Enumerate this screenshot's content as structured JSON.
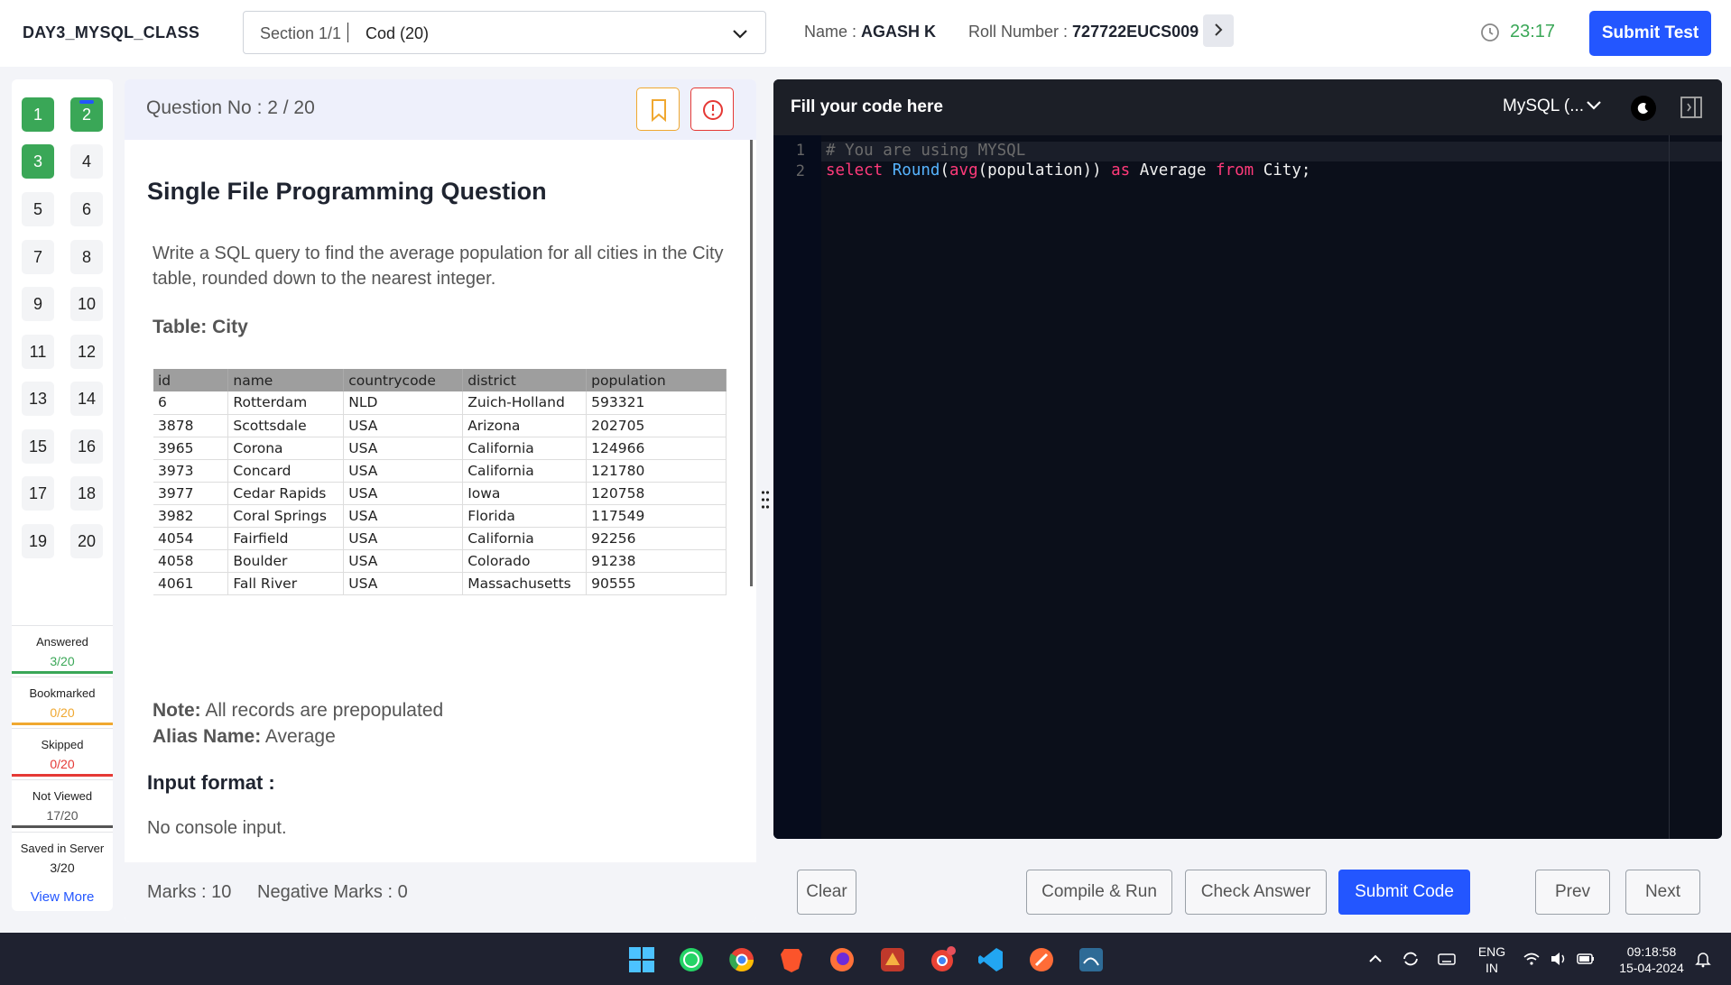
{
  "header": {
    "test_title": "DAY3_MYSQL_CLASS",
    "section_label": "Section 1/1",
    "section_value": "Cod (20)",
    "name_label": "Name :",
    "name_value": "AGASH K",
    "roll_label": "Roll Number :",
    "roll_value": "727722EUCS009",
    "timer": "23:17",
    "submit_test": "Submit Test"
  },
  "qnav": {
    "questions": [
      "1",
      "2",
      "3",
      "4",
      "5",
      "6",
      "7",
      "8",
      "9",
      "10",
      "11",
      "12",
      "13",
      "14",
      "15",
      "16",
      "17",
      "18",
      "19",
      "20"
    ],
    "answered": [
      "1",
      "2",
      "3"
    ],
    "current": "2",
    "stats": [
      {
        "label": "Answered",
        "value": "3/20",
        "color": "#3aa757"
      },
      {
        "label": "Bookmarked",
        "value": "0/20",
        "color": "#f0a830"
      },
      {
        "label": "Skipped",
        "value": "0/20",
        "color": "#e53935"
      },
      {
        "label": "Not Viewed",
        "value": "17/20",
        "color": "#555555"
      },
      {
        "label": "Saved in Server",
        "value": "3/20",
        "color": "#222222"
      }
    ],
    "view_more": "View More"
  },
  "question": {
    "number_label": "Question No : 2 / 20",
    "type_title": "Single File Programming Question",
    "text": "Write a SQL query to find the average population for all cities in the City table, rounded down to the nearest integer.",
    "table_caption": "Table: City",
    "table": {
      "columns": [
        "id",
        "name",
        "countrycode",
        "district",
        "population"
      ],
      "rows": [
        [
          "6",
          "Rotterdam",
          "NLD",
          "Zuich-Holland",
          "593321"
        ],
        [
          "3878",
          "Scottsdale",
          "USA",
          "Arizona",
          "202705"
        ],
        [
          "3965",
          "Corona",
          "USA",
          "California",
          "124966"
        ],
        [
          "3973",
          "Concard",
          "USA",
          "California",
          "121780"
        ],
        [
          "3977",
          "Cedar Rapids",
          "USA",
          "Iowa",
          "120758"
        ],
        [
          "3982",
          "Coral Springs",
          "USA",
          "Florida",
          "117549"
        ],
        [
          "4054",
          "Fairfield",
          "USA",
          "California",
          "92256"
        ],
        [
          "4058",
          "Boulder",
          "USA",
          "Colorado",
          "91238"
        ],
        [
          "4061",
          "Fall River",
          "USA",
          "Massachusetts",
          "90555"
        ]
      ]
    },
    "note_label": "Note:",
    "note_value": "All records are prepopulated",
    "alias_label": "Alias Name:",
    "alias_value": "Average",
    "input_format_title": "Input format :",
    "input_format_value": "No console input.",
    "marks": "Marks : 10",
    "negative_marks": "Negative Marks : 0"
  },
  "editor": {
    "header_label": "Fill your code here",
    "language": "MySQL (...",
    "line_numbers": [
      "1",
      "2"
    ],
    "line1_comment": "# You are using MYSQL",
    "line2": {
      "t1": "select",
      "t2": " ",
      "t3": "Round",
      "t4": "(",
      "t5": "avg",
      "t6": "(population)) ",
      "t7": "as",
      "t8": " Average ",
      "t9": "from",
      "t10": " City;"
    }
  },
  "actions": {
    "clear": "Clear",
    "compile_run": "Compile & Run",
    "check_answer": "Check Answer",
    "submit_code": "Submit Code",
    "prev": "Prev",
    "next": "Next"
  },
  "taskbar": {
    "lang_top": "ENG",
    "lang_bottom": "IN",
    "time": "09:18:58",
    "date": "15-04-2024"
  }
}
